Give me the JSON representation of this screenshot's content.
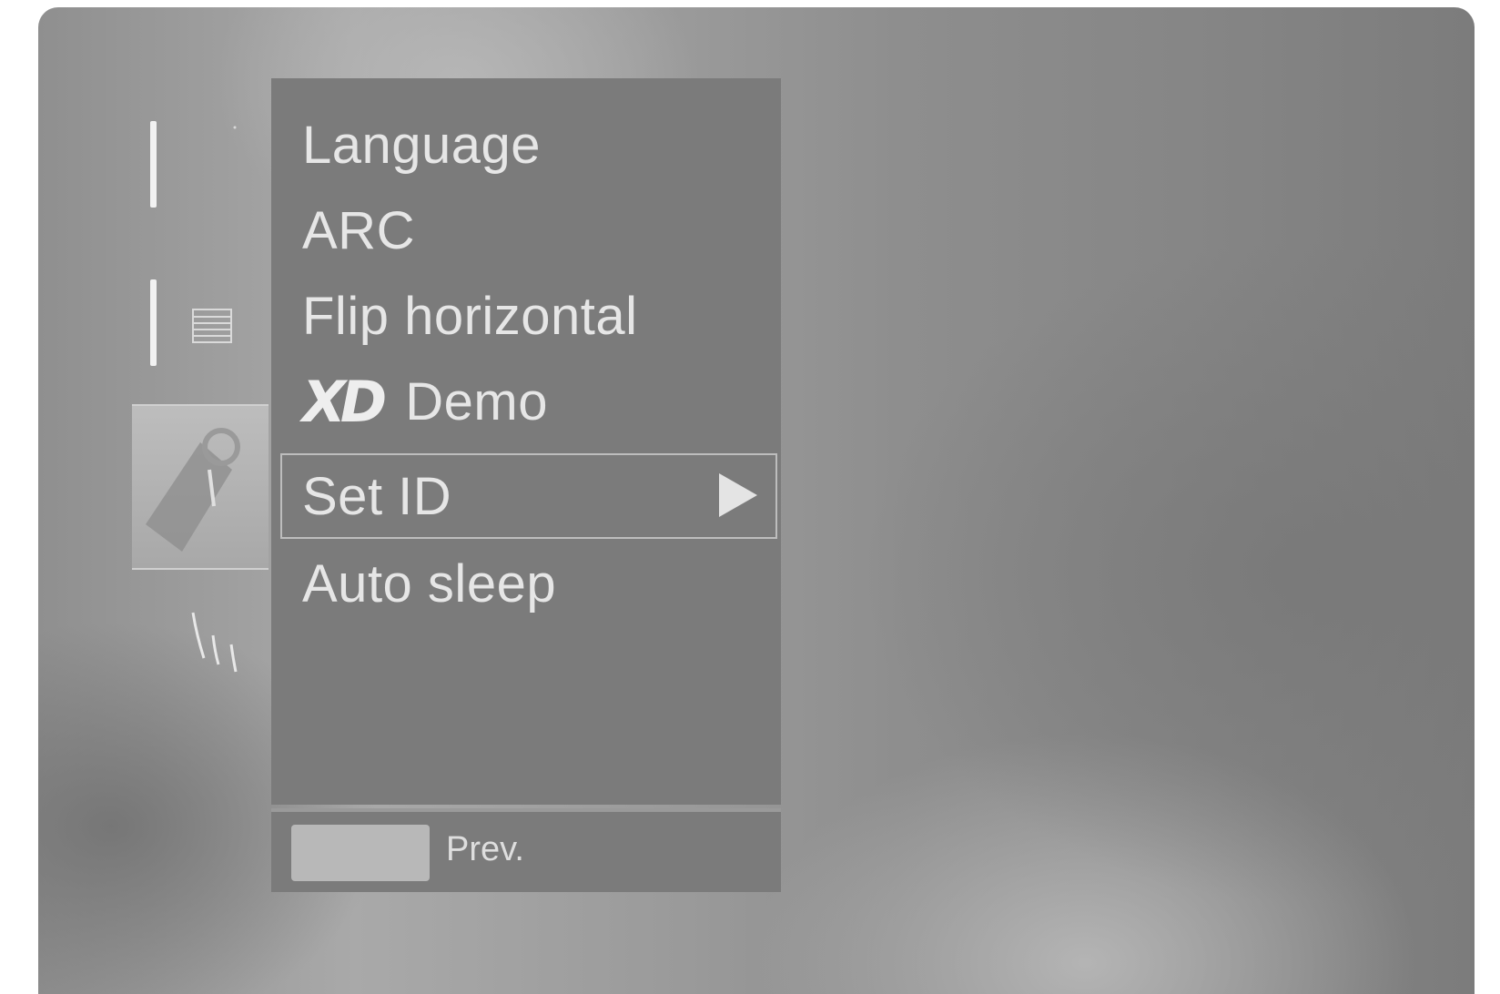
{
  "menu": {
    "items": [
      {
        "label": "Language"
      },
      {
        "label": "ARC"
      },
      {
        "label": "Flip horizontal"
      },
      {
        "logo": "XD",
        "label": "Demo"
      },
      {
        "label": "Set ID",
        "selected": true
      },
      {
        "label": "Auto sleep"
      }
    ]
  },
  "footer": {
    "prev_label": "Prev."
  },
  "icons": {
    "list": "list-icon",
    "selected_category": "tag-icon",
    "submenu_arrow": "arrow-right-icon"
  }
}
